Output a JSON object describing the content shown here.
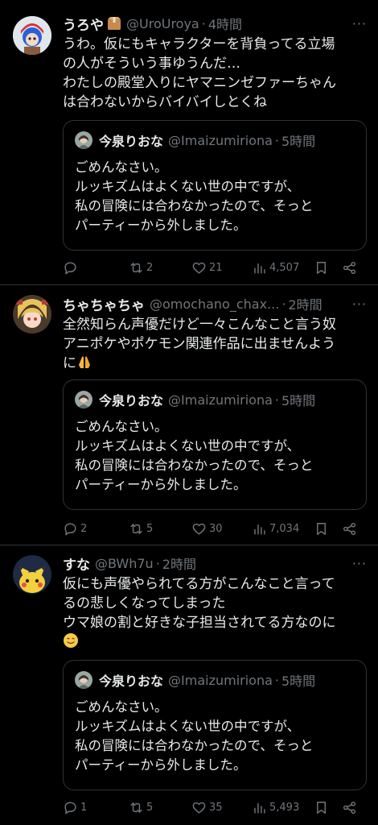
{
  "tweets": [
    {
      "name": "うろや",
      "badge_icon": "package-emoji",
      "handle": "@UroUroya",
      "dot": "·",
      "time": "4時間",
      "more": "···",
      "lines": [
        "うわ。仮にもキャラクターを背負ってる立場",
        "の人がそういう事ゆうんだ…",
        "わたしの殿堂入りにヤマニンゼファーちゃん",
        "は合わないからバイバイしとくね"
      ],
      "emoji": "",
      "quote": {
        "name": "今泉りおな",
        "handle": "@Imaizumiriona",
        "dot": "·",
        "time": "5時間",
        "lines": [
          "ごめんなさい。",
          "ルッキズムはよくない世の中ですが、",
          "私の冒険には合わなかったので、そっと",
          "パーティーから外しました。"
        ]
      },
      "actions": {
        "replies": "",
        "retweets": "2",
        "likes": "21",
        "views": "4,507"
      }
    },
    {
      "name": "ちゃちゃちゃ",
      "badge_icon": "",
      "handle": "@omochano_chax...",
      "dot": "·",
      "time": "2時間",
      "more": "···",
      "lines": [
        "全然知らん声優だけど一々こんなこと言う奴",
        "アニポケやポケモン関連作品に出ませんよう",
        "に"
      ],
      "emoji": "folded-hands-emoji",
      "quote": {
        "name": "今泉りおな",
        "handle": "@Imaizumiriona",
        "dot": "·",
        "time": "5時間",
        "lines": [
          "ごめんなさい。",
          "ルッキズムはよくない世の中ですが、",
          "私の冒険には合わなかったので、そっと",
          "パーティーから外しました。"
        ]
      },
      "actions": {
        "replies": "2",
        "retweets": "5",
        "likes": "30",
        "views": "7,034"
      }
    },
    {
      "name": "すな",
      "badge_icon": "",
      "handle": "@BWh7u",
      "dot": "·",
      "time": "2時間",
      "more": "···",
      "lines": [
        "仮にも声優やられてる方がこんなこと言って",
        "るの悲しくなってしまった",
        "ウマ娘の割と好きな子担当されてる方なのに",
        ""
      ],
      "emoji": "smiling-face-with-tear-emoji",
      "quote": {
        "name": "今泉りおな",
        "handle": "@Imaizumiriona",
        "dot": "·",
        "time": "5時間",
        "lines": [
          "ごめんなさい。",
          "ルッキズムはよくない世の中ですが、",
          "私の冒険には合わなかったので、そっと",
          "パーティーから外しました。"
        ]
      },
      "actions": {
        "replies": "1",
        "retweets": "5",
        "likes": "35",
        "views": "5,493"
      }
    }
  ],
  "colors": {
    "background": "#000000",
    "text": "#e7e9ea",
    "muted": "#71767b",
    "border": "#2f3336"
  }
}
